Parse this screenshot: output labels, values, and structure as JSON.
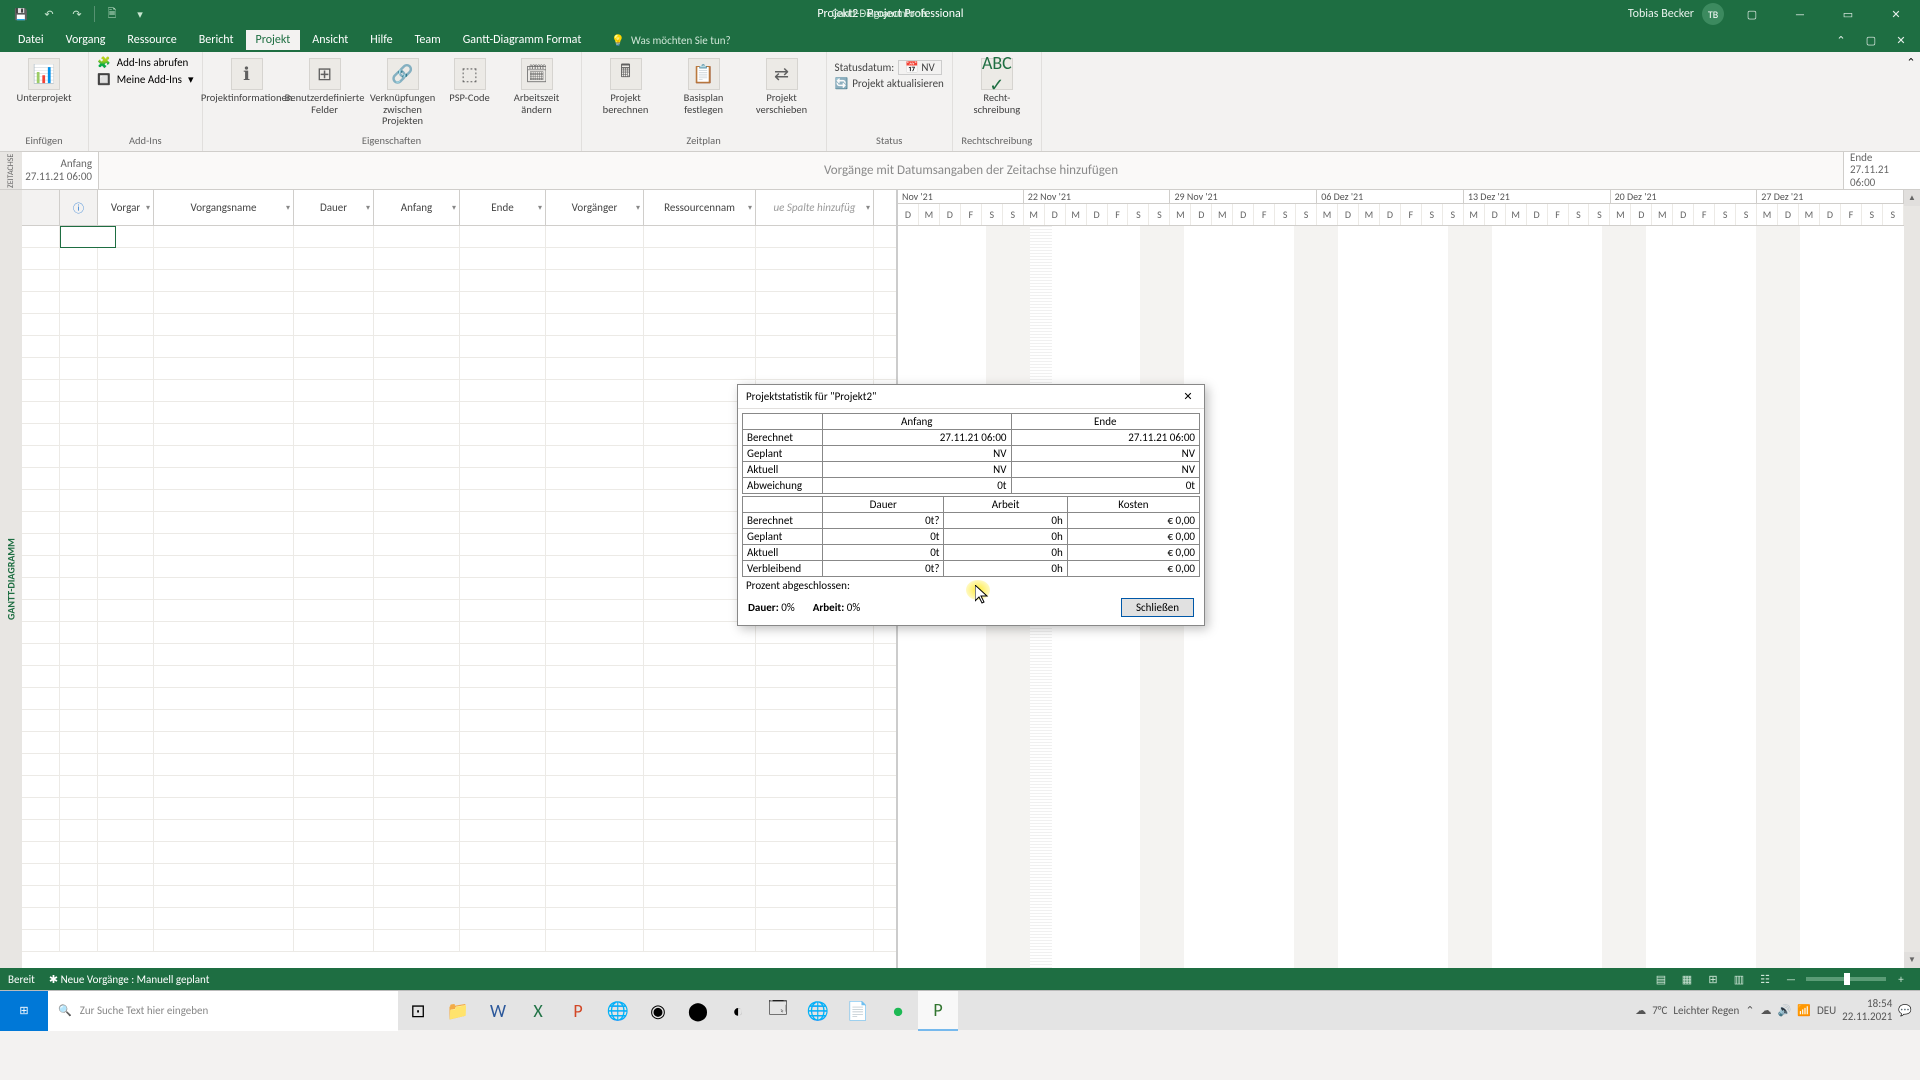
{
  "titlebar": {
    "gantt_tools": "Gantt-Diagrammtools",
    "app_title": "Projekt2  -  Project Professional",
    "user_name": "Tobias Becker",
    "user_initials": "TB"
  },
  "menu": {
    "datei": "Datei",
    "vorgang": "Vorgang",
    "ressource": "Ressource",
    "bericht": "Bericht",
    "projekt": "Projekt",
    "ansicht": "Ansicht",
    "hilfe": "Hilfe",
    "team": "Team",
    "format": "Gantt-Diagramm Format",
    "search_placeholder": "Was möchten Sie tun?"
  },
  "ribbon": {
    "unterprojekt": "Unterprojekt",
    "einfuegen_grp": "Einfügen",
    "addins_abrufen": "Add-Ins abrufen",
    "meine_addins": "Meine Add-Ins",
    "addins_grp": "Add-Ins",
    "projektinfo": "Projektinformationen",
    "benutzerfelder": "Benutzerdefinierte Felder",
    "verknuepfungen": "Verknüpfungen zwischen Projekten",
    "psp": "PSP-Code",
    "arbeitszeit": "Arbeitszeit ändern",
    "eig_grp": "Eigenschaften",
    "projekt_berechnen": "Projekt berechnen",
    "basisplan": "Basisplan festlegen",
    "projekt_verschieben": "Projekt verschieben",
    "zeitplan_grp": "Zeitplan",
    "statusdatum_lbl": "Statusdatum:",
    "statusdatum_val": "NV",
    "projekt_aktualisieren": "Projekt aktualisieren",
    "status_grp": "Status",
    "rechtschreibung": "Recht-schreibung",
    "recht_grp": "Rechtschreibung"
  },
  "timeline": {
    "side": "ZEITACHSE",
    "anfang_lbl": "Anfang",
    "anfang_val": "27.11.21 06:00",
    "ende_lbl": "Ende",
    "ende_val": "27.11.21 06:00",
    "hint": "Vorgänge mit Datumsangaben der Zeitachse hinzufügen"
  },
  "grid": {
    "side": "GANTT-DIAGRAMM",
    "cols": {
      "vorgar": "Vorgar",
      "vorgangsname": "Vorgangsname",
      "dauer": "Dauer",
      "anfang": "Anfang",
      "ende": "Ende",
      "vorgaenger": "Vorgänger",
      "ressourcen": "Ressourcennam",
      "neue_spalte": "ue Spalte hinzufüg"
    }
  },
  "weeks": [
    "Nov '21",
    "22 Nov '21",
    "29 Nov '21",
    "06 Dez '21",
    "13 Dez '21",
    "20 Dez '21",
    "27 Dez '21"
  ],
  "days": [
    "D",
    "M",
    "D",
    "F",
    "S",
    "S",
    "M",
    "D",
    "M",
    "D",
    "F",
    "S",
    "S",
    "M",
    "D",
    "M",
    "D",
    "F",
    "S",
    "S",
    "M",
    "D",
    "M",
    "D",
    "F",
    "S",
    "S",
    "M",
    "D",
    "M",
    "D",
    "F",
    "S",
    "S",
    "M",
    "D",
    "M",
    "D",
    "F",
    "S",
    "S",
    "M",
    "D",
    "M",
    "D",
    "F",
    "S",
    "S"
  ],
  "dialog": {
    "title": "Projektstatistik für \"Projekt2\"",
    "cols1": {
      "anfang": "Anfang",
      "ende": "Ende"
    },
    "rows1": {
      "berechnet": {
        "lbl": "Berechnet",
        "a": "27.11.21 06:00",
        "e": "27.11.21 06:00"
      },
      "geplant": {
        "lbl": "Geplant",
        "a": "NV",
        "e": "NV"
      },
      "aktuell": {
        "lbl": "Aktuell",
        "a": "NV",
        "e": "NV"
      },
      "abweichung": {
        "lbl": "Abweichung",
        "a": "0t",
        "e": "0t"
      }
    },
    "cols2": {
      "dauer": "Dauer",
      "arbeit": "Arbeit",
      "kosten": "Kosten"
    },
    "rows2": {
      "berechnet": {
        "lbl": "Berechnet",
        "d": "0t?",
        "a": "0h",
        "k": "€ 0,00"
      },
      "geplant": {
        "lbl": "Geplant",
        "d": "0t",
        "a": "0h",
        "k": "€ 0,00"
      },
      "aktuell": {
        "lbl": "Aktuell",
        "d": "0t",
        "a": "0h",
        "k": "€ 0,00"
      },
      "verbleibend": {
        "lbl": "Verbleibend",
        "d": "0t?",
        "a": "0h",
        "k": "€ 0,00"
      }
    },
    "prozent_lbl": "Prozent abgeschlossen:",
    "dauer_lbl": "Dauer:",
    "dauer_val": "0%",
    "arbeit_lbl": "Arbeit:",
    "arbeit_val": "0%",
    "close_btn": "Schließen"
  },
  "statusbar": {
    "bereit": "Bereit",
    "neue_vorgaenge": "Neue Vorgänge : Manuell geplant"
  },
  "taskbar": {
    "search_placeholder": "Zur Suche Text hier eingeben",
    "weather_temp": "7°C",
    "weather_txt": "Leichter Regen",
    "lang": "DEU",
    "time": "18:54",
    "date": "22.11.2021"
  }
}
